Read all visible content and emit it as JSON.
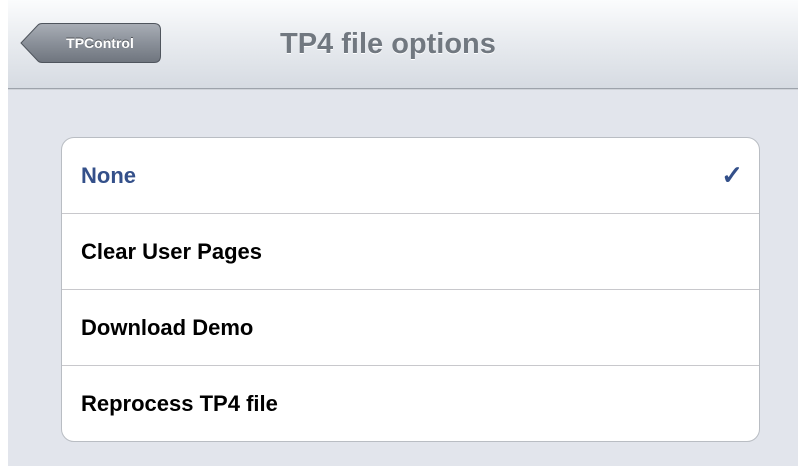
{
  "navbar": {
    "back_label": "TPControl",
    "title": "TP4 file options"
  },
  "options": [
    {
      "label": "None",
      "selected": true
    },
    {
      "label": "Clear User Pages",
      "selected": false
    },
    {
      "label": "Download Demo",
      "selected": false
    },
    {
      "label": "Reprocess TP4 file",
      "selected": false
    }
  ],
  "checkmark": "✓",
  "colors": {
    "selected_text": "#34508a",
    "background": "#e2e5ec"
  }
}
